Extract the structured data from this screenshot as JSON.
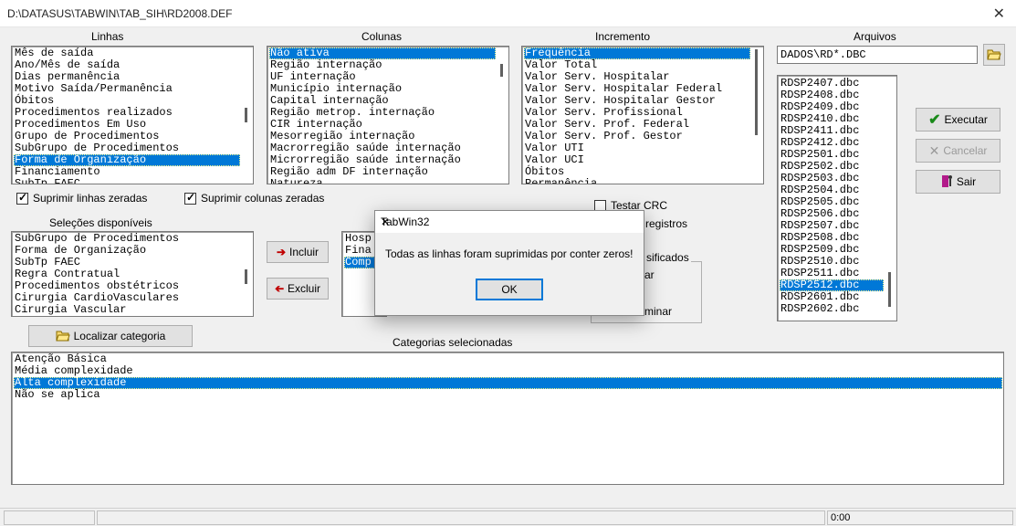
{
  "window": {
    "title": "D:\\DATASUS\\TABWIN\\TAB_SIH\\RD2008.DEF",
    "close": "✕"
  },
  "labels": {
    "linhas": "Linhas",
    "colunas": "Colunas",
    "incremento": "Incremento",
    "arquivos": "Arquivos",
    "selecoes": "Seleções disponíveis",
    "categorias": "Categorias selecionadas"
  },
  "linhas": {
    "items": [
      "Mês de saída",
      "Ano/Mês de saída",
      "Dias permanência",
      "Motivo Saída/Permanência",
      "Óbitos",
      "Procedimentos realizados",
      "Procedimentos Em Uso",
      "Grupo de Procedimentos",
      "SubGrupo de Procedimentos",
      "Forma de Organização",
      "Financiamento",
      "SubTp FAEC"
    ],
    "selected": 9
  },
  "colunas": {
    "items": [
      "Não ativa",
      "Região internação",
      "UF internação",
      "Município internação",
      "Capital internação",
      "Região metrop. internação",
      "CIR internação",
      "Mesorregião internação",
      "Macrorregião saúde internação",
      "Microrregião saúde internação",
      "Região adm DF internação",
      "Natureza"
    ],
    "selected": 0
  },
  "incremento": {
    "items": [
      "Frequência",
      "Valor Total",
      "Valor Serv. Hospitalar",
      "Valor Serv. Hospitalar Federal",
      "Valor Serv. Hospitalar Gestor",
      "Valor Serv. Profissional",
      "Valor Serv. Prof. Federal",
      "Valor Serv. Prof. Gestor",
      "Valor UTI",
      "Valor UCI",
      "Óbitos",
      "Permanência"
    ],
    "selected": 0
  },
  "arquivos": {
    "filter": "DADOS\\RD*.DBC",
    "items": [
      "RDSP2407.dbc",
      "RDSP2408.dbc",
      "RDSP2409.dbc",
      "RDSP2410.dbc",
      "RDSP2411.dbc",
      "RDSP2412.dbc",
      "RDSP2501.dbc",
      "RDSP2502.dbc",
      "RDSP2503.dbc",
      "RDSP2504.dbc",
      "RDSP2505.dbc",
      "RDSP2506.dbc",
      "RDSP2507.dbc",
      "RDSP2508.dbc",
      "RDSP2509.dbc",
      "RDSP2510.dbc",
      "RDSP2511.dbc",
      "RDSP2512.dbc",
      "RDSP2601.dbc",
      "RDSP2602.dbc"
    ],
    "selected": 17
  },
  "buttons": {
    "executar": "Executar",
    "cancelar": "Cancelar",
    "sair": "Sair",
    "incluir": "Incluir",
    "excluir": "Excluir",
    "localizar": "Localizar categoria",
    "ok": "OK"
  },
  "checkboxes": {
    "suprimir_linhas": "Suprimir linhas zeradas",
    "suprimir_colunas": "Suprimir colunas zeradas",
    "testar_crc": "Testar CRC",
    "registros": "registros"
  },
  "selecoes": {
    "items": [
      "SubGrupo de Procedimentos",
      "Forma de Organização",
      "SubTp FAEC",
      "Regra Contratual",
      "Procedimentos obstétricos",
      "Cirurgia CardioVasculares",
      "Cirurgia Vascular"
    ]
  },
  "selecionadas_partial": {
    "items": [
      "Hosp",
      "Fina",
      "Comp"
    ],
    "selected": 2
  },
  "classificados": {
    "title": "sificados",
    "opt1": "ar",
    "opt2": "minar"
  },
  "categorias": {
    "items": [
      "Atenção Básica",
      "Média complexidade",
      "Alta complexidade",
      "Não se aplica"
    ],
    "selected": 2
  },
  "status": {
    "time": "0:00"
  },
  "dialog": {
    "title": "TabWin32",
    "message": "Todas as linhas foram suprimidas por conter zeros!",
    "close": "✕"
  }
}
